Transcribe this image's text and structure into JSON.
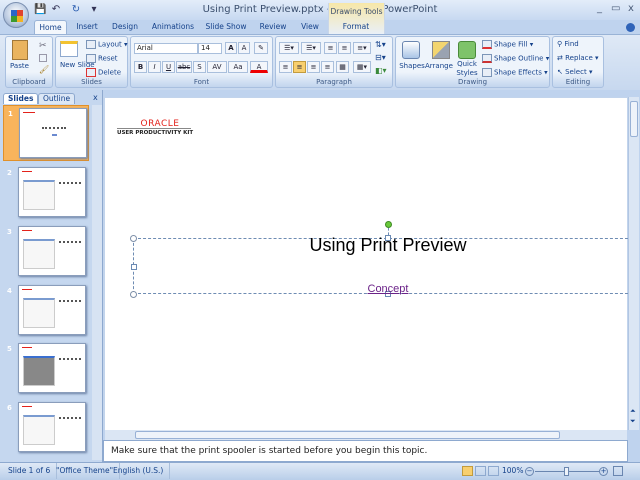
{
  "window": {
    "title": "Using Print Preview.pptx - Microsoft PowerPoint",
    "context_tab_group": "Drawing Tools",
    "minimize": "_",
    "restore": "▭",
    "close": "x"
  },
  "qat": {
    "save": "💾",
    "undo": "↶",
    "redo": "↻",
    "customize": "▾"
  },
  "tabs": [
    "Home",
    "Insert",
    "Design",
    "Animations",
    "Slide Show",
    "Review",
    "View",
    "Format"
  ],
  "ribbon": {
    "clipboard": {
      "label": "Clipboard",
      "paste": "Paste"
    },
    "slides": {
      "label": "Slides",
      "new_slide": "New Slide",
      "layout": "Layout",
      "reset": "Reset",
      "delete": "Delete"
    },
    "font": {
      "label": "Font",
      "font_name": "Arial",
      "font_size": "14",
      "bold": "B",
      "italic": "I",
      "underline": "U",
      "strike": "abc",
      "shadow": "S",
      "spacing": "AV",
      "case": "Aa",
      "grow": "A",
      "shrink": "A",
      "color": "A"
    },
    "paragraph": {
      "label": "Paragraph"
    },
    "drawing": {
      "label": "Drawing",
      "shapes": "Shapes",
      "arrange": "Arrange",
      "quick_styles": "Quick Styles",
      "shape_fill": "Shape Fill",
      "shape_outline": "Shape Outline",
      "shape_effects": "Shape Effects"
    },
    "editing": {
      "label": "Editing",
      "find": "Find",
      "replace": "Replace",
      "select": "Select"
    }
  },
  "pane": {
    "tabs": [
      "Slides",
      "Outline"
    ],
    "close": "x",
    "slides": [
      "1",
      "2",
      "3",
      "4",
      "5",
      "6"
    ],
    "selected": 1
  },
  "slide": {
    "logo_brand": "ORACLE",
    "logo_sub": "USER PRODUCTIVITY KIT",
    "title": "Using Print Preview",
    "subtitle": "Concept"
  },
  "notes": "Make sure that the print spooler is started before you begin this topic.",
  "status": {
    "slide": "Slide 1 of 6",
    "theme": "\"Office Theme\"",
    "language": "English (U.S.)",
    "zoom": "100%",
    "zoom_level": 100
  }
}
